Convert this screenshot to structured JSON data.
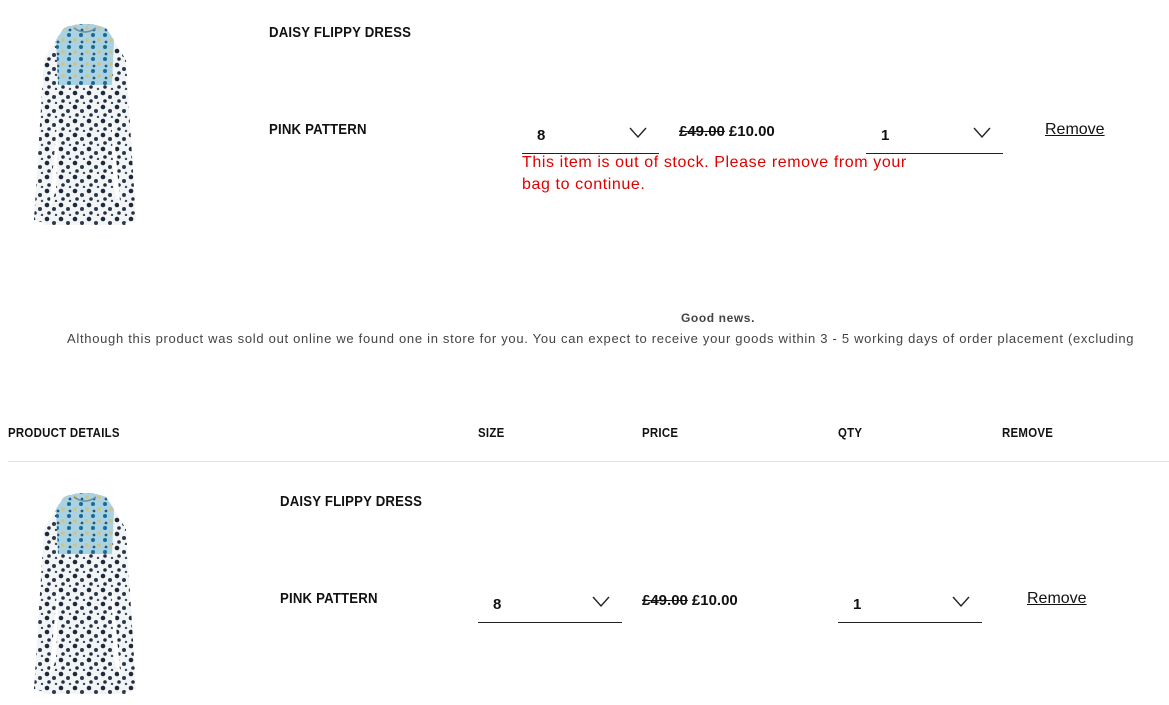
{
  "items": [
    {
      "name": "DAISY FLIPPY DRESS",
      "colour": "PINK PATTERN",
      "size": "8",
      "price_old": "£49.00",
      "price_new": "£10.00",
      "qty": "1",
      "remove_label": "Remove",
      "error": "This item is out of stock. Please remove from your bag to continue."
    },
    {
      "name": "DAISY FLIPPY DRESS",
      "colour": "PINK PATTERN",
      "size": "8",
      "price_old": "£49.00",
      "price_new": "£10.00",
      "qty": "1",
      "remove_label": "Remove"
    }
  ],
  "notice": {
    "title": "Good news.",
    "body": "Although this product was sold out online we found one in store for you. You can expect to receive your goods within 3 - 5 working days of order placement (excluding"
  },
  "table_headers": {
    "details": "PRODUCT DETAILS",
    "size": "SIZE",
    "price": "PRICE",
    "qty": "QTY",
    "remove": "REMOVE"
  },
  "colors": {
    "error": "#e00000",
    "text": "#111111",
    "divider": "#e0e0e0",
    "dress_blue": "#7fb6cf"
  },
  "icons": [
    "dress-image",
    "chevron-down-icon"
  ]
}
